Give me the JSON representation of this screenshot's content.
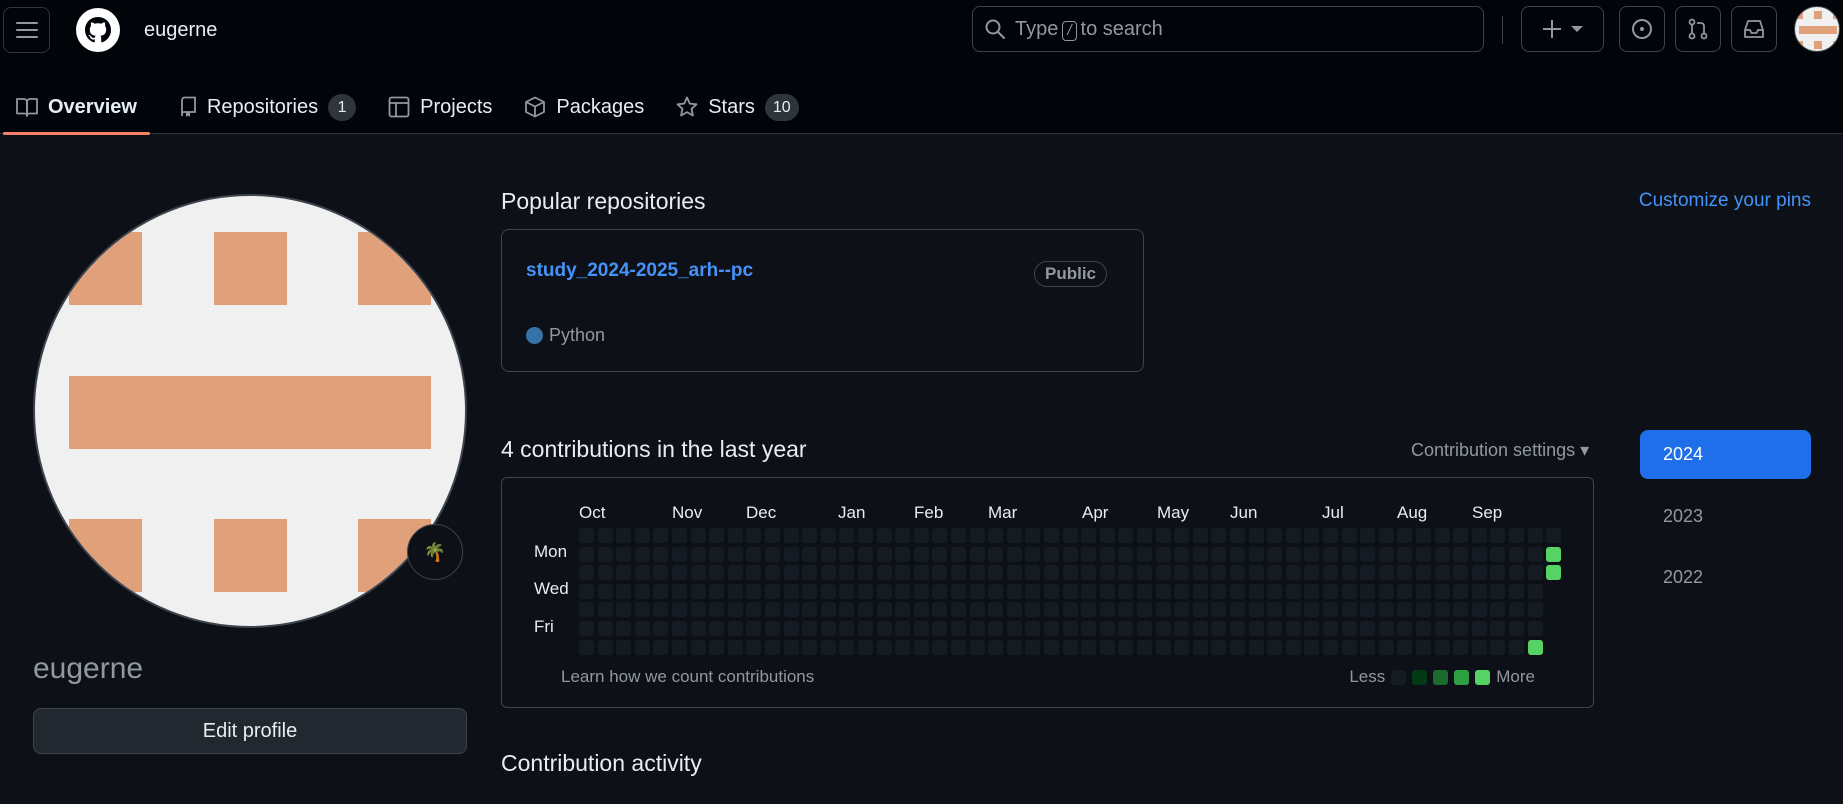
{
  "header": {
    "username": "eugerne",
    "search": {
      "prefix": "Type",
      "key": "/",
      "suffix": "to search"
    }
  },
  "tabs": [
    {
      "label": "Overview",
      "count": null,
      "active": true
    },
    {
      "label": "Repositories",
      "count": "1"
    },
    {
      "label": "Projects",
      "count": null
    },
    {
      "label": "Packages",
      "count": null
    },
    {
      "label": "Stars",
      "count": "10"
    }
  ],
  "profile": {
    "name": "eugerne",
    "status_emoji": "🌴",
    "edit_label": "Edit profile"
  },
  "popular": {
    "heading": "Popular repositories",
    "customize_label": "Customize your pins",
    "repo": {
      "name": "study_2024-2025_arh--pc",
      "visibility": "Public",
      "language": "Python",
      "language_color": "#3572A5"
    }
  },
  "contributions": {
    "heading": "4 contributions in the last year",
    "settings_label": "Contribution settings ▾",
    "months": [
      "Oct",
      "Nov",
      "Dec",
      "Jan",
      "Feb",
      "Mar",
      "Apr",
      "May",
      "Jun",
      "Jul",
      "Aug",
      "Sep"
    ],
    "days": [
      "Mon",
      "Wed",
      "Fri"
    ],
    "learn_label": "Learn how we count contributions",
    "legend_less": "Less",
    "legend_more": "More",
    "level_colors": [
      "#151b23",
      "#033a16",
      "#196c2e",
      "#2ea043",
      "#56d364"
    ],
    "active_days": [
      {
        "week": 52,
        "day": 1,
        "level": 4
      },
      {
        "week": 52,
        "day": 2,
        "level": 4
      },
      {
        "week": 51,
        "day": 6,
        "level": 4
      }
    ],
    "weeks": 53
  },
  "years": [
    "2024",
    "2023",
    "2022"
  ],
  "activity_heading": "Contribution activity"
}
